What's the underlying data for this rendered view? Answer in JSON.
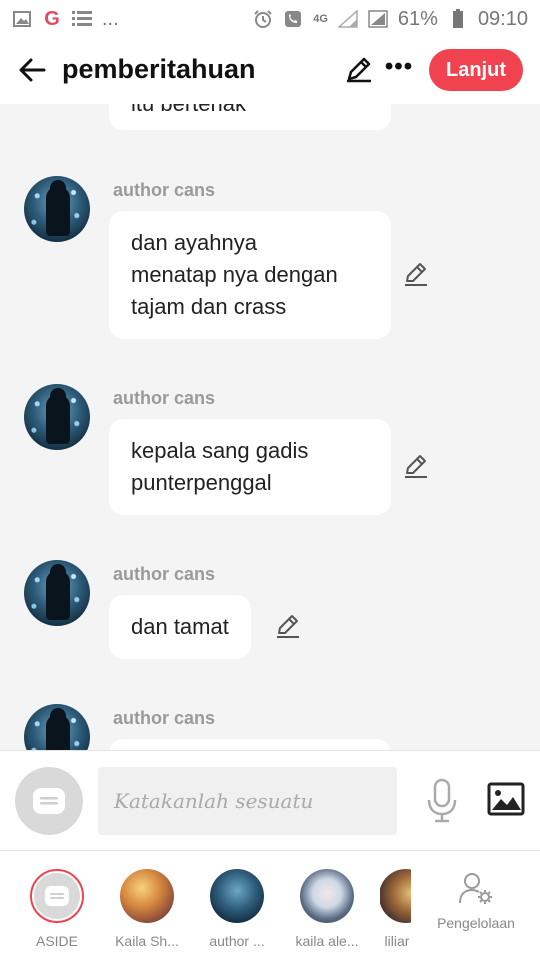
{
  "status_bar": {
    "network": "4G",
    "battery": "61%",
    "time": "09:10",
    "dots": "..."
  },
  "header": {
    "title": "pemberitahuan",
    "next_label": "Lanjut",
    "more_label": "•••"
  },
  "messages": [
    {
      "author": "",
      "text": "itu bertenak",
      "partial": true
    },
    {
      "author": "author cans",
      "text_lines": [
        "dan ayahnya",
        "menatap nya dengan",
        "tajam dan crass"
      ]
    },
    {
      "author": "author cans",
      "text_lines": [
        "kepala sang gadis",
        "punterpenggal"
      ]
    },
    {
      "author": "author cans",
      "text_lines": [
        "dan tamat"
      ]
    },
    {
      "author": "author cans",
      "text_lines": []
    }
  ],
  "input": {
    "placeholder": "Katakanlah sesuatu"
  },
  "roster": [
    {
      "label": "ASIDE"
    },
    {
      "label": "Kaila Sh..."
    },
    {
      "label": "author ..."
    },
    {
      "label": "kaila ale..."
    },
    {
      "label": "liliar"
    }
  ],
  "manage": {
    "label": "Pengelolaan"
  },
  "colors": {
    "accent": "#f0424f",
    "background": "#f4f4f4",
    "author_name": "#9a9a9a"
  }
}
